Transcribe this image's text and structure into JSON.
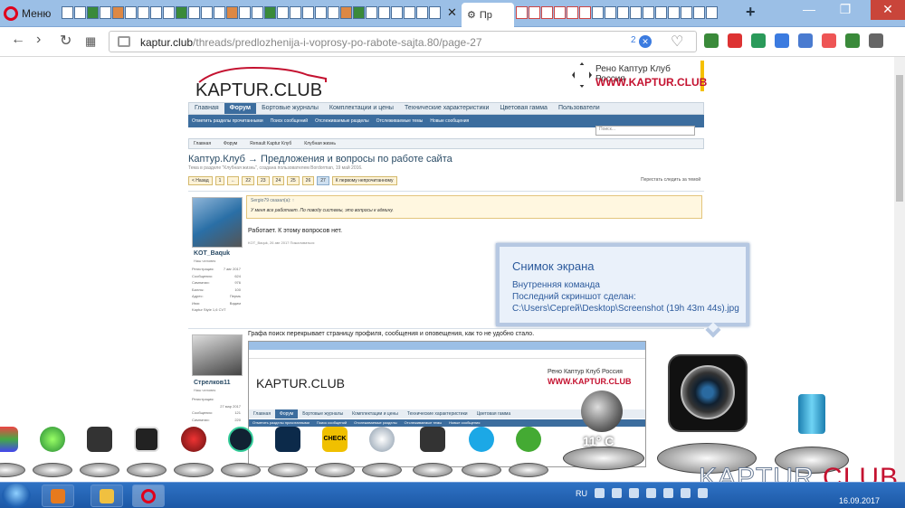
{
  "browser": {
    "menu_label": "Меню",
    "active_tab_title": "Пр",
    "url_host": "kaptur.club",
    "url_path": "/threads/predlozhenija-i-voprosy-po-rabote-sajta.80/page-27",
    "url_badge_count": "2"
  },
  "site": {
    "logo_text": "KAPTUR.CLUB",
    "renault_line1": "Рено Каптур Клуб Россия",
    "renault_line2": "WWW.KAPTUR.CLUB",
    "nav": [
      "Главная",
      "Форум",
      "Бортовые журналы",
      "Комплектации и цены",
      "Технические характеристики",
      "Цветовая гамма",
      "Пользователи"
    ],
    "subnav": [
      "Отметить разделы прочитанными",
      "Поиск сообщений",
      "Отслеживаемые разделы",
      "Отслеживаемые темы",
      "Новые сообщения"
    ],
    "search_placeholder": "Поиск...",
    "breadcrumbs": [
      "Главная",
      "Форум",
      "Renault Kaptur Клуб",
      "Клубная жизнь"
    ],
    "thread_title": "Каптур.Клуб → Предложения и вопросы по работе сайта",
    "thread_sub": "Тема в разделе \"Клубная жизнь\", создана пользователем Bordorman, 19 май 2016.",
    "pager": [
      "< Назад",
      "1",
      "←",
      "22",
      "23",
      "24",
      "25",
      "26",
      "27",
      "К первому непрочитанному"
    ],
    "watch_link": "Перестать следить за темой"
  },
  "post1": {
    "username": "KOT_Baquk",
    "role": "Наш человек",
    "stats": [
      [
        "Регистрация:",
        "7 авг 2017"
      ],
      [
        "Сообщения:",
        "624"
      ],
      [
        "Симпатии:",
        "976"
      ],
      [
        "Баллы:",
        "100"
      ],
      [
        "Адрес:",
        "Пермь"
      ],
      [
        "Имя:",
        "Вадим"
      ]
    ],
    "car": "Kaptur Style 1,6 CVT",
    "quote_head": "Sergio79 сказал(а): ↑",
    "quote_text": "У меня все работает. По поводу системы, это вопросы к админу.",
    "message": "Работает. К этому вопросов нет.",
    "meta": "KOT_Baquk, 26 авг 2017   Пожаловаться"
  },
  "post2": {
    "username": "Стрелков11",
    "role": "Наш человек",
    "stats": [
      [
        "Регистрация:",
        "27 мар 2017"
      ],
      [
        "Сообщения:",
        "121"
      ],
      [
        "Симпатии:",
        "220"
      ]
    ],
    "message": "Графа поиск перекрывает страницу профиля, сообщения и оповещения, как то не удобно стало."
  },
  "notification": {
    "title": "Снимок экрана",
    "line1": "Внутренняя команда",
    "line2": "Последний скриншот сделан:",
    "line3": "C:\\Users\\Сергей\\Desktop\\Screenshot (19h 43m 44s).jpg"
  },
  "widgets": {
    "temperature": "11° C",
    "dock_check_label": "CHECK"
  },
  "watermark": {
    "part1": "KAPTUR.",
    "part2": "CLUB"
  },
  "taskbar": {
    "language": "RU",
    "date": "16.09.2017"
  },
  "colors": {
    "opera_red": "#e0001b",
    "forum_blue": "#3c6d9e",
    "renault_red": "#c41230",
    "taskbar_blue": "#1c58a6"
  }
}
